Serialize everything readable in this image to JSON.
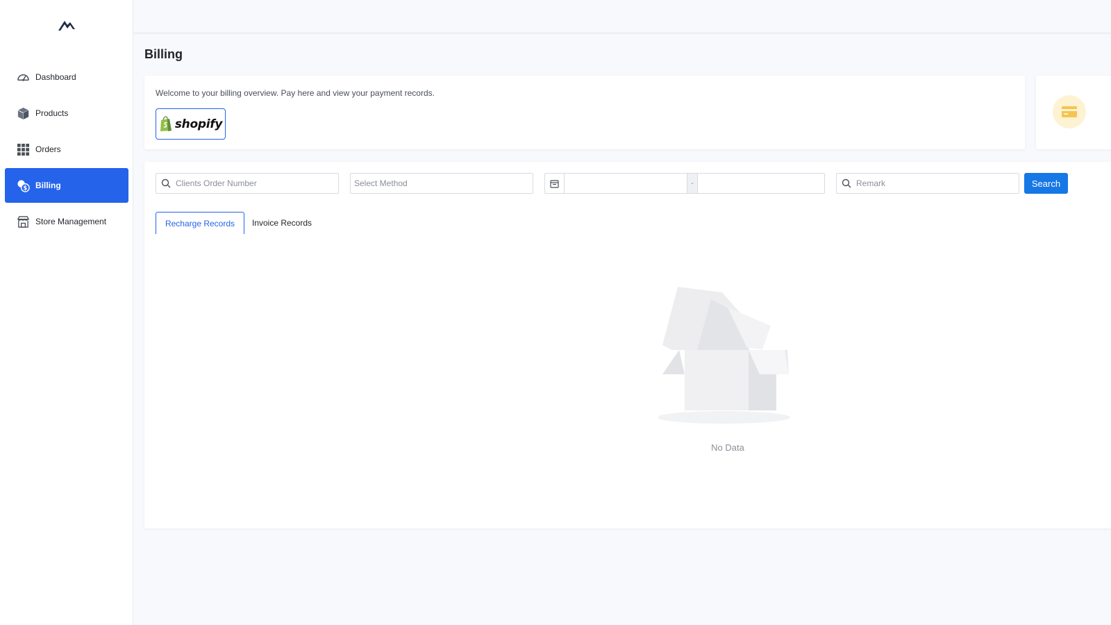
{
  "sidebar": {
    "logo_icon": "mountain-logo",
    "items": [
      {
        "label": "Dashboard",
        "icon": "gauge-icon",
        "active": false
      },
      {
        "label": "Products",
        "icon": "box-icon",
        "active": false
      },
      {
        "label": "Orders",
        "icon": "grid-icon",
        "active": false
      },
      {
        "label": "Billing",
        "icon": "coins-icon",
        "active": true
      },
      {
        "label": "Store Management",
        "icon": "store-icon",
        "active": false
      }
    ]
  },
  "page": {
    "title": "Billing"
  },
  "welcome": {
    "text": "Welcome to your billing overview. Pay here and view your payment records.",
    "shopify_label": "shopify"
  },
  "side_card": {
    "icon": "credit-card-icon"
  },
  "filters": {
    "order_placeholder": "Clients Order Number",
    "method_placeholder": "Select Method",
    "date_separator": "-",
    "remark_placeholder": "Remark",
    "search_label": "Search"
  },
  "tabs": [
    {
      "label": "Recharge Records",
      "active": true
    },
    {
      "label": "Invoice Records",
      "active": false
    }
  ],
  "empty_state": {
    "text": "No Data"
  },
  "colors": {
    "accent": "#2563eb",
    "search_button": "#1677e6",
    "card_icon_bg": "#fdf3d3",
    "card_icon": "#f5c451"
  }
}
